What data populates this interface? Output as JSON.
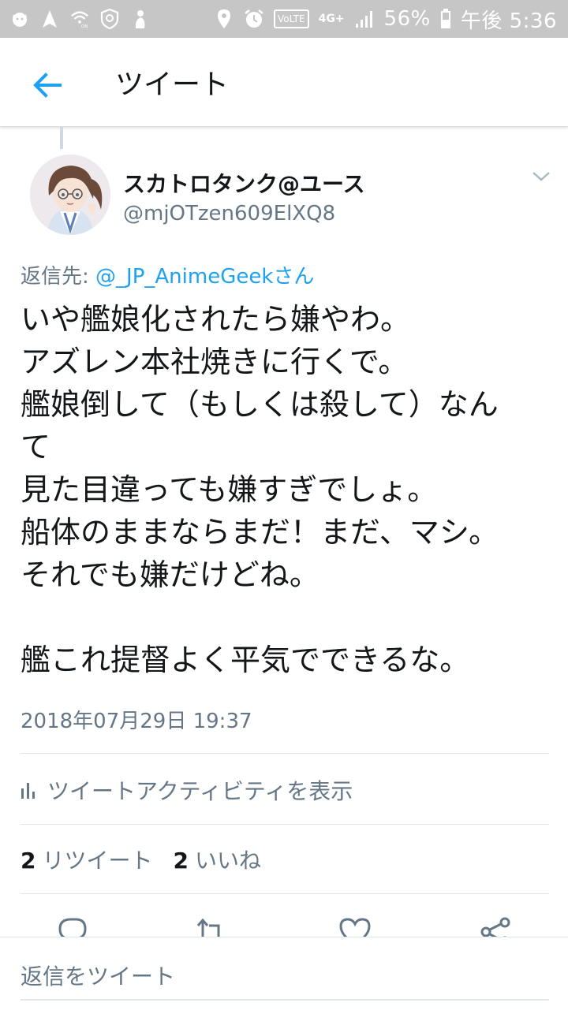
{
  "status_bar": {
    "battery": "56%",
    "time": "午後 5:36",
    "volte": "VoLTE",
    "network": "4G+",
    "icons_left": [
      "cat-icon",
      "navigation-icon",
      "wifi-calling-icon",
      "shield-icon",
      "figure-icon"
    ],
    "icons_right": [
      "location-icon",
      "alarm-icon",
      "volte-icon",
      "network-icon",
      "signal-icon",
      "battery-icon"
    ]
  },
  "appbar": {
    "title": "ツイート",
    "back_icon": "back-arrow-icon"
  },
  "tweet": {
    "display_name": "スカトロタンク@ユース",
    "handle": "@mjOTzen609ElXQ8",
    "reply_prefix": "返信先: ",
    "reply_mention": "@_JP_AnimeGeekさん",
    "lines": [
      "いや艦娘化されたら嫌やわ。",
      "アズレン本社焼きに行くで。",
      "艦娘倒して（もしくは殺して）なん",
      "て",
      "見た目違っても嫌すぎでしょ。",
      "船体のままならまだ！まだ、マシ。",
      "それでも嫌だけどね。",
      "",
      "艦これ提督よく平気でできるな。"
    ],
    "timestamp": "2018年07月29日 19:37",
    "activity_label": "ツイートアクティビティを表示",
    "retweet_count": "2",
    "retweet_label": "リツイート",
    "like_count": "2",
    "like_label": "いいね"
  },
  "actions": [
    "reply-icon",
    "retweet-icon",
    "like-icon",
    "share-icon"
  ],
  "reply_bar": {
    "placeholder": "返信をツイート"
  },
  "colors": {
    "status_bar": "#c6c6c6",
    "accent": "#1da1f2",
    "secondary_text": "#657786",
    "divider": "#e1e8ed"
  }
}
